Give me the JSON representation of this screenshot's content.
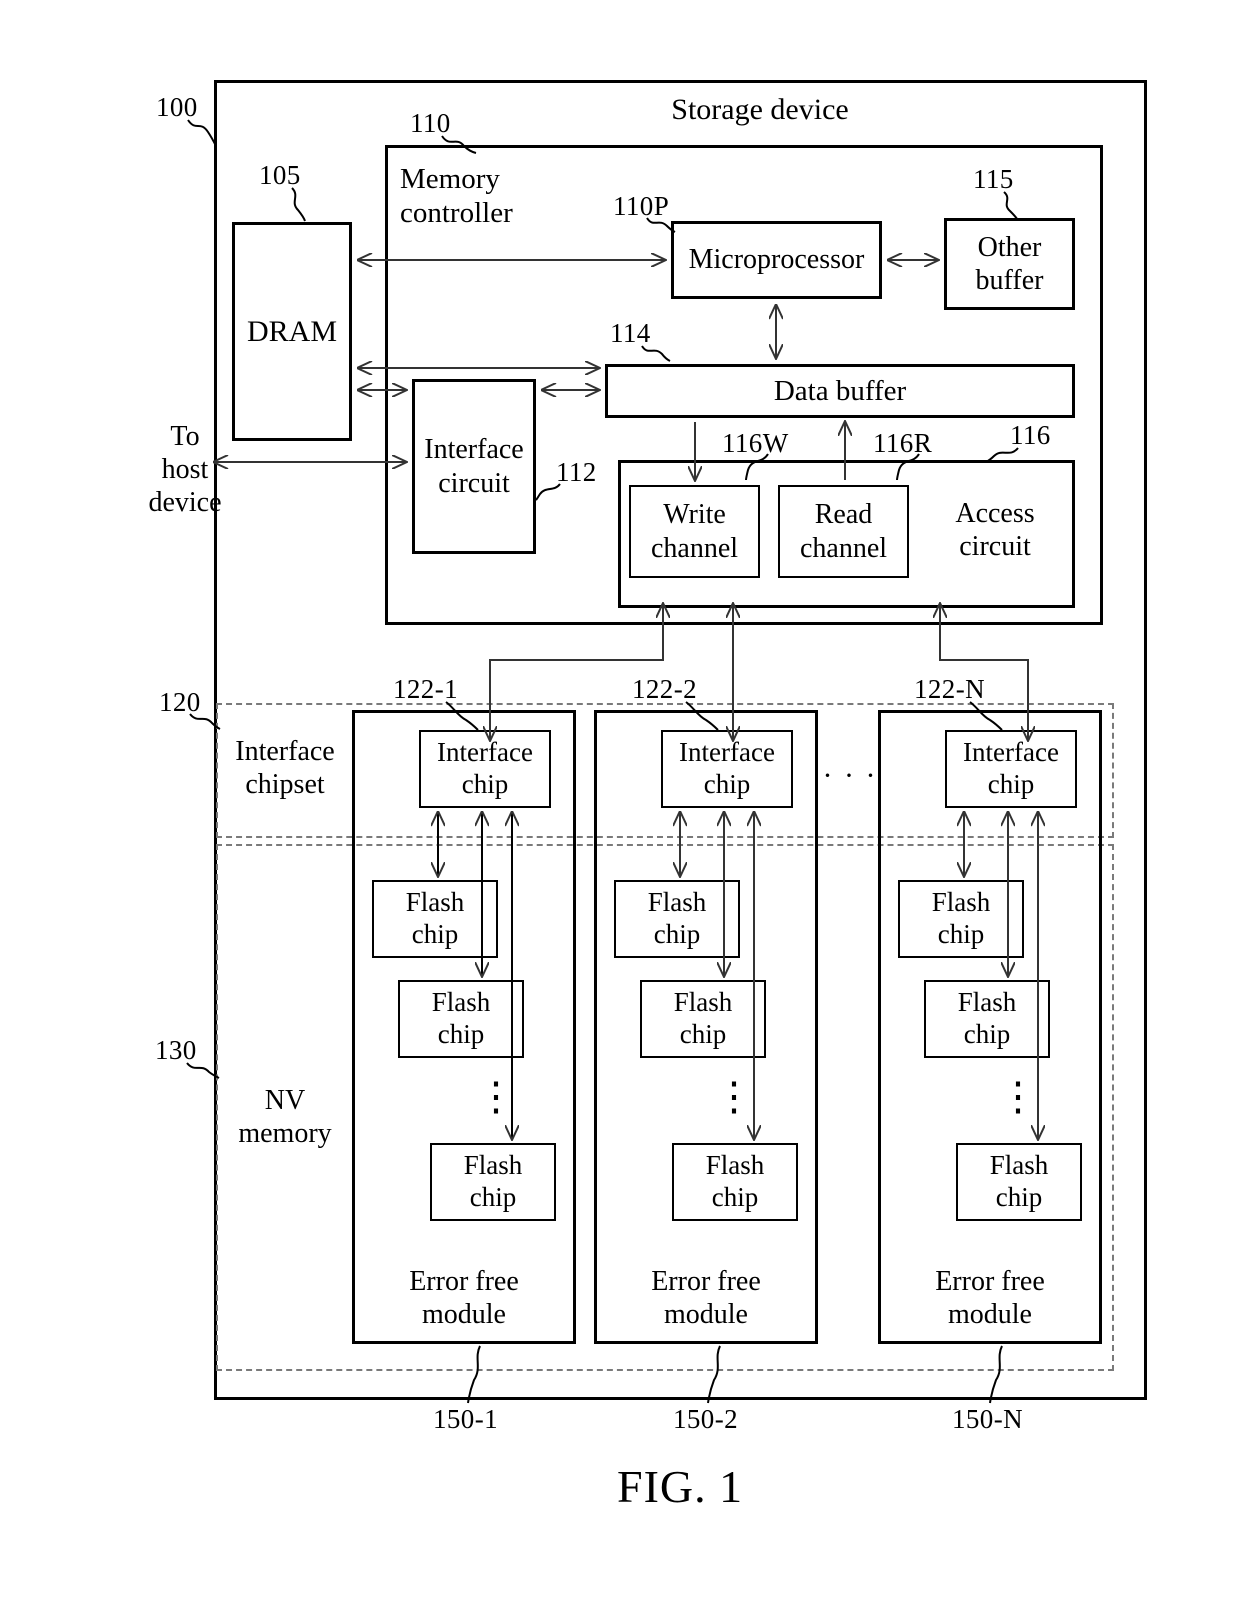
{
  "figure": {
    "caption": "FIG. 1",
    "title": "Storage device"
  },
  "refs": {
    "device": "100",
    "dram": "105",
    "memory_controller": "110",
    "microprocessor": "110P",
    "interface_circuit": "112",
    "data_buffer": "114",
    "other_buffer": "115",
    "access_circuit": "116",
    "write_channel": "116W",
    "read_channel": "116R",
    "interface_chipset": "120",
    "interface_chip_1": "122-1",
    "interface_chip_2": "122-2",
    "interface_chip_n": "122-N",
    "nv_memory": "130",
    "module_1": "150-1",
    "module_2": "150-2",
    "module_n": "150-N"
  },
  "blocks": {
    "storage_device": "Storage device",
    "memory_controller": "Memory\ncontroller",
    "dram": "DRAM",
    "microprocessor": "Microprocessor",
    "other_buffer": "Other\nbuffer",
    "data_buffer": "Data buffer",
    "interface_circuit": "Interface\ncircuit",
    "access_circuit": "Access\ncircuit",
    "write_channel": "Write\nchannel",
    "read_channel": "Read\nchannel",
    "interface_chipset": "Interface\nchipset",
    "nv_memory": "NV\nmemory",
    "interface_chip": "Interface\nchip",
    "flash_chip": "Flash\nchip",
    "error_free_module": "Error free\nmodule"
  },
  "external": {
    "to_host": "To\nhost\ndevice"
  },
  "ellipsis": {
    "horizontal": "· · ·",
    "vertical": "⋮"
  },
  "columns": [
    {
      "chip_ref": "122-1",
      "module_ref": "150-1",
      "interface_chip": "Interface\nchip",
      "flash_chips": [
        "Flash\nchip",
        "Flash\nchip",
        "Flash\nchip"
      ],
      "module_label": "Error free\nmodule"
    },
    {
      "chip_ref": "122-2",
      "module_ref": "150-2",
      "interface_chip": "Interface\nchip",
      "flash_chips": [
        "Flash\nchip",
        "Flash\nchip",
        "Flash\nchip"
      ],
      "module_label": "Error free\nmodule"
    },
    {
      "chip_ref": "122-N",
      "module_ref": "150-N",
      "interface_chip": "Interface\nchip",
      "flash_chips": [
        "Flash\nchip",
        "Flash\nchip",
        "Flash\nchip"
      ],
      "module_label": "Error free\nmodule"
    }
  ],
  "colors": {
    "ink": "#000000",
    "line": "#333333",
    "dashed": "#7a7a7a",
    "background": "#ffffff"
  }
}
